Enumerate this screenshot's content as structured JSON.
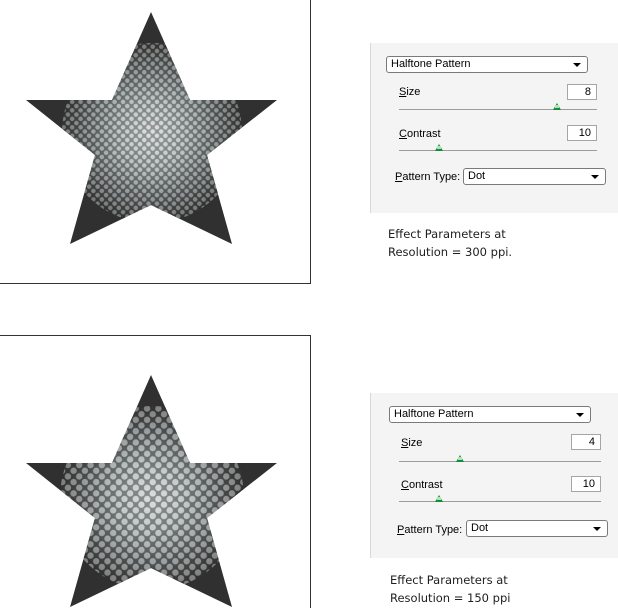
{
  "panels": [
    {
      "filter_name": "Halftone Pattern",
      "size_label_first": "S",
      "size_label_rest": "ize",
      "size_value": "8",
      "size_level": 0.8,
      "contrast_label_first": "C",
      "contrast_label_rest": "ontrast",
      "contrast_value": "10",
      "contrast_level": 0.2,
      "pattern_label_first": "P",
      "pattern_label_rest": "attern Type:",
      "pattern_value": "Dot",
      "caption_line1": "Effect Parameters at",
      "caption_line2": "Resolution = 300 ppi."
    },
    {
      "filter_name": "Halftone Pattern",
      "size_label_first": "S",
      "size_label_rest": "ize",
      "size_value": "4",
      "size_level": 0.3,
      "contrast_label_first": "C",
      "contrast_label_rest": "ontrast",
      "contrast_value": "10",
      "contrast_level": 0.2,
      "pattern_label_first": "P",
      "pattern_label_rest": "attern Type:",
      "pattern_value": "Dot",
      "caption_line1": "Effect Parameters at",
      "caption_line2": "Resolution = 150 ppi"
    }
  ],
  "colors": {
    "star_fill": "#303030",
    "star_highlight": "#e8eeee",
    "slider_thumb": "#1a8a3a"
  },
  "icons": {
    "dropdown_arrow": "chevron-down-icon",
    "slider_thumb": "slider-thumb-icon"
  }
}
